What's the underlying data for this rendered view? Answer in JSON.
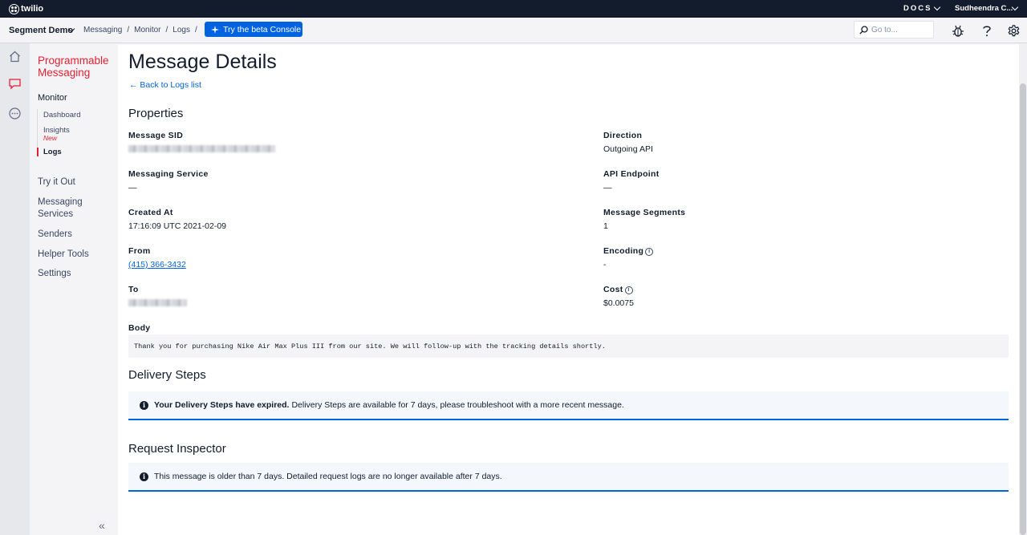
{
  "topbar": {
    "logo_text": "twilio",
    "docs_label": "DOCS",
    "user_name": "Sudheendra C..."
  },
  "subbar": {
    "account": "Segment Demo",
    "breadcrumbs": [
      "Messaging",
      "Monitor",
      "Logs"
    ],
    "beta_button": "Try the beta Console",
    "search_placeholder": "Go to..."
  },
  "sidebar": {
    "product_title": "Programmable Messaging",
    "section": "Monitor",
    "sub_items": [
      {
        "label": "Dashboard"
      },
      {
        "label": "Insights",
        "badge": "New"
      },
      {
        "label": "Logs",
        "active": true
      }
    ],
    "links": [
      "Try it Out",
      "Messaging Services",
      "Senders",
      "Helper Tools",
      "Settings"
    ]
  },
  "main": {
    "title": "Message Details",
    "back_link": "← Back to Logs list",
    "properties_heading": "Properties",
    "properties": {
      "message_sid_label": "Message SID",
      "messaging_service_label": "Messaging Service",
      "messaging_service_value": "—",
      "created_at_label": "Created At",
      "created_at_value": "17:16:09 UTC 2021-02-09",
      "from_label": "From",
      "from_value": "(415) 366-3432",
      "to_label": "To",
      "direction_label": "Direction",
      "direction_value": "Outgoing API",
      "api_endpoint_label": "API Endpoint",
      "api_endpoint_value": "—",
      "segments_label": "Message Segments",
      "segments_value": "1",
      "encoding_label": "Encoding",
      "encoding_value": "-",
      "cost_label": "Cost",
      "cost_value": "$0.0075"
    },
    "body_label": "Body",
    "body_text": "Thank you for purchasing Nike Air Max Plus III from our site. We will follow-up with the tracking details shortly.",
    "delivery_heading": "Delivery Steps",
    "delivery_notice_bold": "Your Delivery Steps have expired.",
    "delivery_notice_text": "Delivery Steps are available for 7 days, please troubleshoot with a more recent message.",
    "inspector_heading": "Request Inspector",
    "inspector_notice_text": "This message is older than 7 days. Detailed request logs are no longer available after 7 days."
  }
}
